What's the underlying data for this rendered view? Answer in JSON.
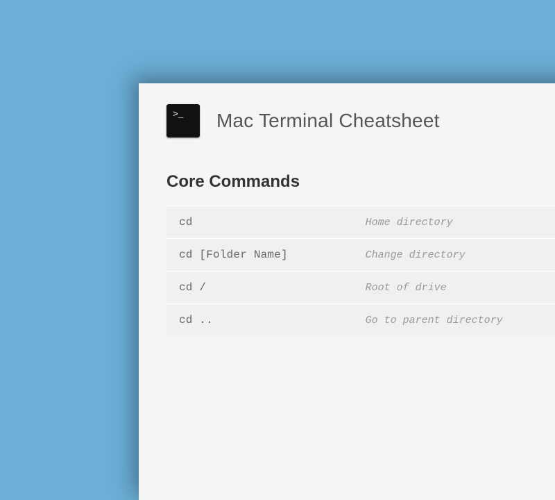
{
  "header": {
    "icon_glyph": ">_",
    "title": "Mac Terminal Cheatsheet"
  },
  "section": {
    "title": "Core Commands",
    "rows": [
      {
        "command": "cd",
        "description": "Home directory"
      },
      {
        "command": "cd [Folder Name]",
        "description": "Change directory"
      },
      {
        "command": "cd /",
        "description": "Root of drive"
      },
      {
        "command": "cd ..",
        "description": "Go to parent directory"
      }
    ]
  }
}
